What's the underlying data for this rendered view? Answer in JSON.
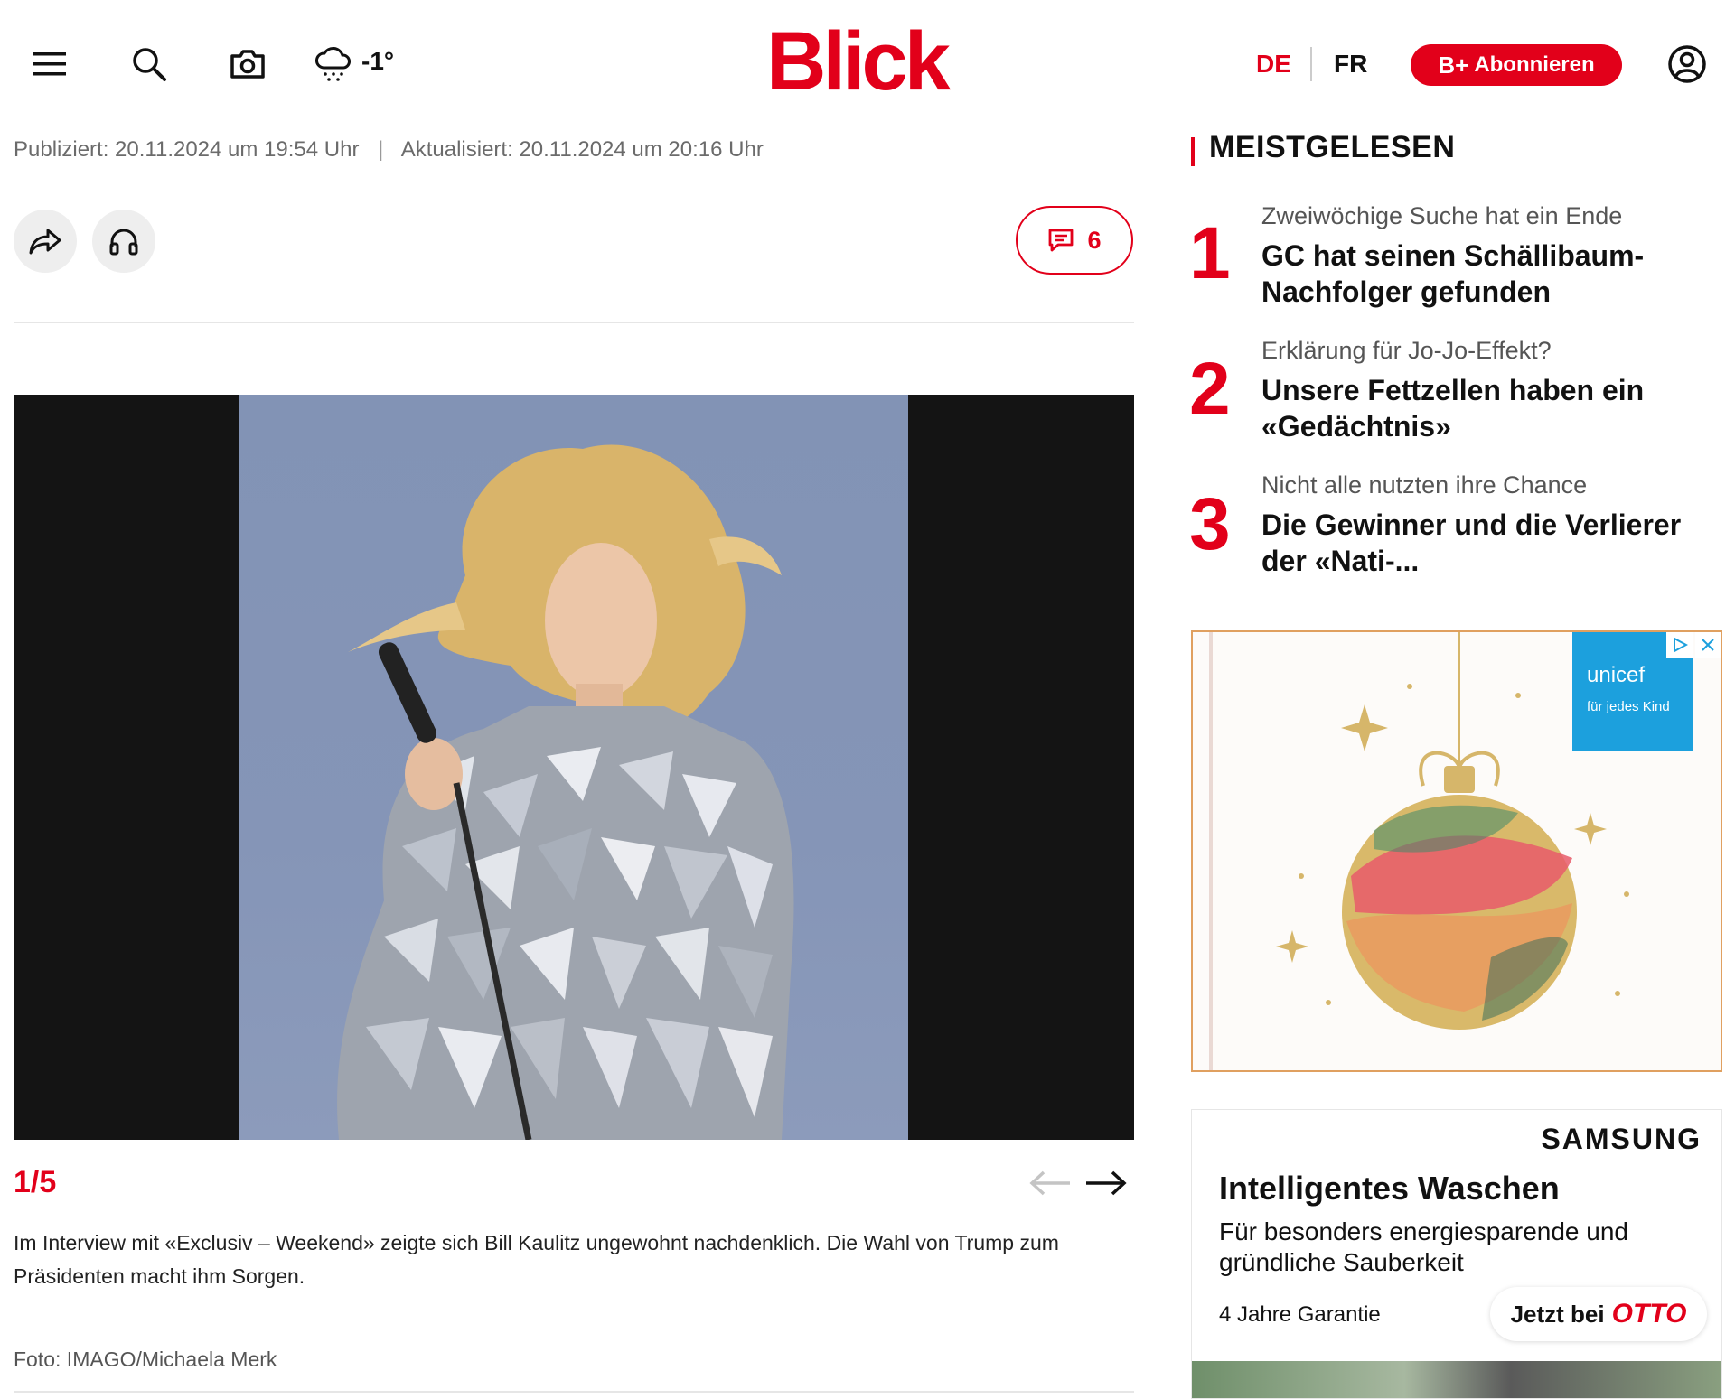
{
  "header": {
    "menu_icon": "menu-icon",
    "search_icon": "search-icon",
    "camera_icon": "camera-icon",
    "weather_icon": "snow-cloud-icon",
    "temperature": "-1°",
    "logo": "Blick",
    "lang_de": "DE",
    "lang_fr": "FR",
    "subscribe_badge": "B+",
    "subscribe_label": "Abonnieren",
    "account_icon": "user-icon",
    "brand_color": "#e2001a"
  },
  "article": {
    "published": "Publiziert: 20.11.2024 um 19:54 Uhr",
    "separator": "|",
    "updated": "Aktualisiert: 20.11.2024 um 20:16 Uhr",
    "share_icon": "share-icon",
    "audio_icon": "headphones-icon",
    "comment_icon": "comment-icon",
    "comment_count": "6"
  },
  "gallery": {
    "counter": "1/5",
    "prev_icon": "arrow-left-icon",
    "next_icon": "arrow-right-icon",
    "caption": "Im Interview mit «Exclusiv – Weekend» zeigte sich Bill Kaulitz ungewohnt nachdenklich. Die Wahl von Trump zum Präsidenten macht ihm Sorgen.",
    "credit": "Foto: IMAGO/Michaela Merk"
  },
  "sidebar": {
    "title": "MEISTGELESEN",
    "items": [
      {
        "rank": "1",
        "kicker": "Zweiwöchige Suche hat ein Ende",
        "headline": "GC hat seinen Schällibaum-Nachfolger gefunden"
      },
      {
        "rank": "2",
        "kicker": "Erklärung für Jo-Jo-Effekt?",
        "headline": "Unsere Fettzellen haben ein «Gedächtnis»"
      },
      {
        "rank": "3",
        "kicker": "Nicht alle nutzten ihre Chance",
        "headline": "Die Gewinner und die Verlierer der «Nati-..."
      }
    ]
  },
  "ad_unicef": {
    "brand": "unicef",
    "tagline": "für jedes Kind",
    "adchoices_icon": "adchoices-icon",
    "close_icon": "close-icon"
  },
  "ad_samsung": {
    "brand": "SAMSUNG",
    "headline": "Intelligentes Waschen",
    "subline": "Für besonders energiesparende und gründliche Sauberkeit",
    "guarantee": "4 Jahre Garantie",
    "cta": "Jetzt bei",
    "cta_brand": "OTTO"
  }
}
